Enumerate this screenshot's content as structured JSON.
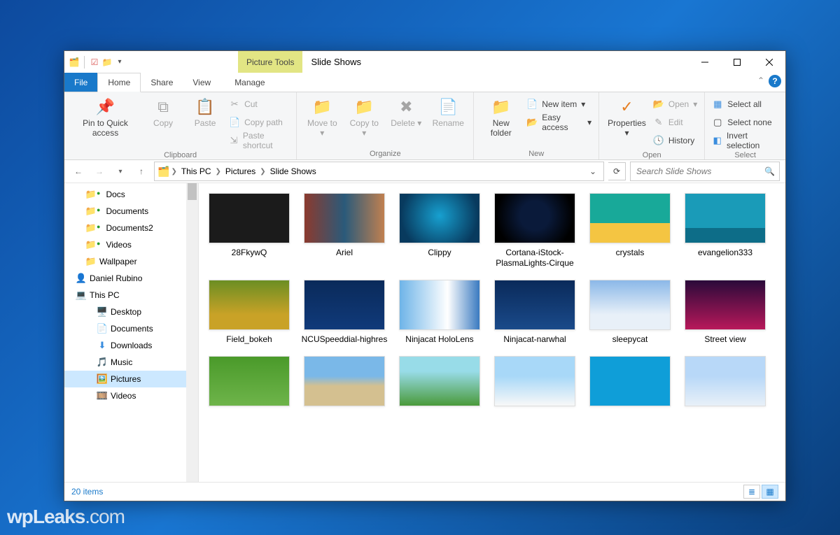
{
  "window": {
    "context_tab": "Picture Tools",
    "title": "Slide Shows"
  },
  "tabs": {
    "file": "File",
    "home": "Home",
    "share": "Share",
    "view": "View",
    "manage": "Manage"
  },
  "ribbon": {
    "clipboard": {
      "label": "Clipboard",
      "pin": "Pin to Quick access",
      "copy": "Copy",
      "paste": "Paste",
      "cut": "Cut",
      "copy_path": "Copy path",
      "paste_shortcut": "Paste shortcut"
    },
    "organize": {
      "label": "Organize",
      "move_to": "Move to",
      "copy_to": "Copy to",
      "delete": "Delete",
      "rename": "Rename"
    },
    "new": {
      "label": "New",
      "new_folder": "New folder",
      "new_item": "New item",
      "easy_access": "Easy access"
    },
    "open": {
      "label": "Open",
      "properties": "Properties",
      "open": "Open",
      "edit": "Edit",
      "history": "History"
    },
    "select": {
      "label": "Select",
      "select_all": "Select all",
      "select_none": "Select none",
      "invert": "Invert selection"
    }
  },
  "breadcrumb": [
    "This PC",
    "Pictures",
    "Slide Shows"
  ],
  "search": {
    "placeholder": "Search Slide Shows"
  },
  "tree": {
    "docs": "Docs",
    "documents": "Documents",
    "documents2": "Documents2",
    "videos": "Videos",
    "wallpaper": "Wallpaper",
    "user": "Daniel Rubino",
    "this_pc": "This PC",
    "desktop": "Desktop",
    "downloads": "Downloads",
    "music": "Music",
    "pictures": "Pictures",
    "videos2": "Videos"
  },
  "items": [
    {
      "name": "28FkywQ",
      "cls": "th-dark"
    },
    {
      "name": "Ariel",
      "cls": "th-blur"
    },
    {
      "name": "Clippy",
      "cls": "th-clippy"
    },
    {
      "name": "Cortana-iStock-PlasmaLights-Cirque",
      "cls": "th-cortana"
    },
    {
      "name": "crystals",
      "cls": "th-crystals"
    },
    {
      "name": "evangelion333",
      "cls": "th-eva"
    },
    {
      "name": "Field_bokeh",
      "cls": "th-field"
    },
    {
      "name": "NCUSpeeddial-highres",
      "cls": "th-ncu"
    },
    {
      "name": "Ninjacat HoloLens",
      "cls": "th-ninja"
    },
    {
      "name": "Ninjacat-narwhal",
      "cls": "th-narwhal"
    },
    {
      "name": "sleepycat",
      "cls": "th-sleepy"
    },
    {
      "name": "Street view",
      "cls": "th-street"
    },
    {
      "name": "",
      "cls": "th-green"
    },
    {
      "name": "",
      "cls": "th-beach"
    },
    {
      "name": "",
      "cls": "th-green2"
    },
    {
      "name": "",
      "cls": "th-cat"
    },
    {
      "name": "",
      "cls": "th-ms"
    },
    {
      "name": "",
      "cls": "th-mtn"
    }
  ],
  "status": {
    "count": "20 items"
  },
  "watermark": {
    "brand": "wpLeaks",
    "suffix": ".com"
  }
}
